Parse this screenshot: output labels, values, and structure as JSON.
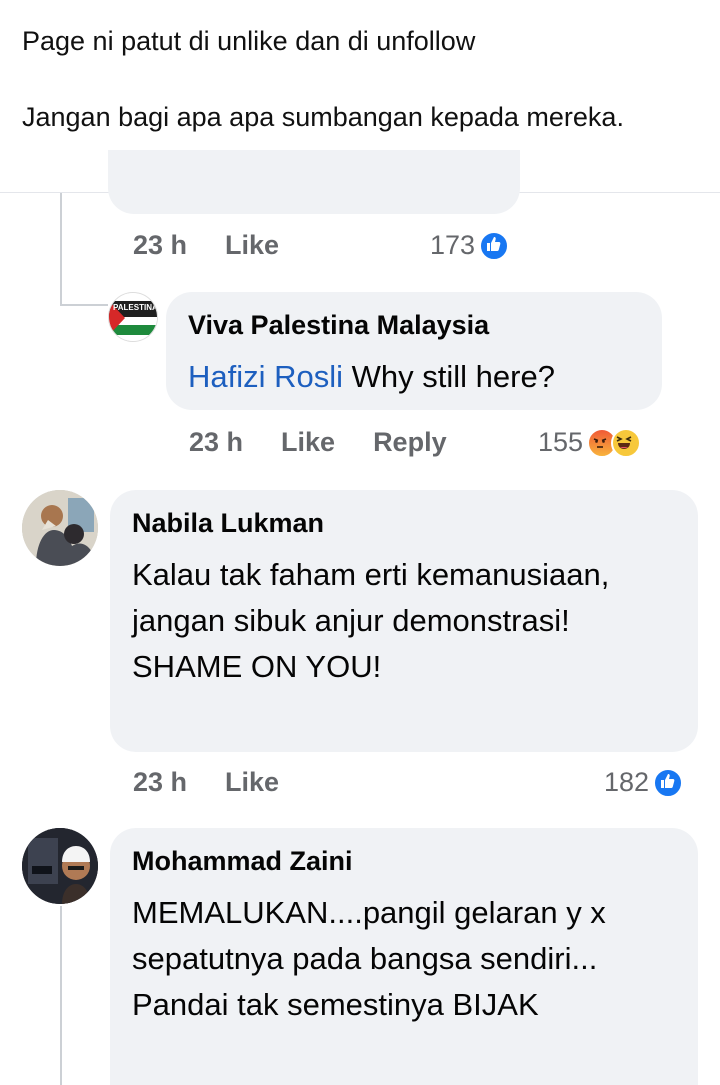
{
  "caption": {
    "line1": "Page ni patut di unlike dan di unfollow",
    "line2": "Jangan bagi apa apa sumbangan kepada mereka."
  },
  "comments": [
    {
      "time": "23 h",
      "like": "Like",
      "reactions": "173",
      "reaction_icons": [
        "like-icon"
      ]
    },
    {
      "author": "Viva Palestina Malaysia",
      "mention": "Hafizi Rosli",
      "text": " Why still here?",
      "time": "23 h",
      "like": "Like",
      "reply": "Reply",
      "reactions": "155",
      "reaction_icons": [
        "angry-icon",
        "haha-icon"
      ],
      "avatar_text": "PALESTINA"
    },
    {
      "author": "Nabila Lukman",
      "text": "Kalau tak faham erti kemanusiaan, jangan sibuk anjur demonstrasi! SHAME ON YOU!",
      "time": "23 h",
      "like": "Like",
      "reactions": "182",
      "reaction_icons": [
        "like-icon"
      ]
    },
    {
      "author": "Mohammad Zaini",
      "text": "MEMALUKAN....pangil gelaran y x sepatutnya pada bangsa sendiri... Pandai tak semestinya BIJAK"
    }
  ],
  "colors": {
    "bubble": "#f0f2f5",
    "meta": "#65676b",
    "mention": "#1d5fbf",
    "like_blue": "#1877f2"
  }
}
